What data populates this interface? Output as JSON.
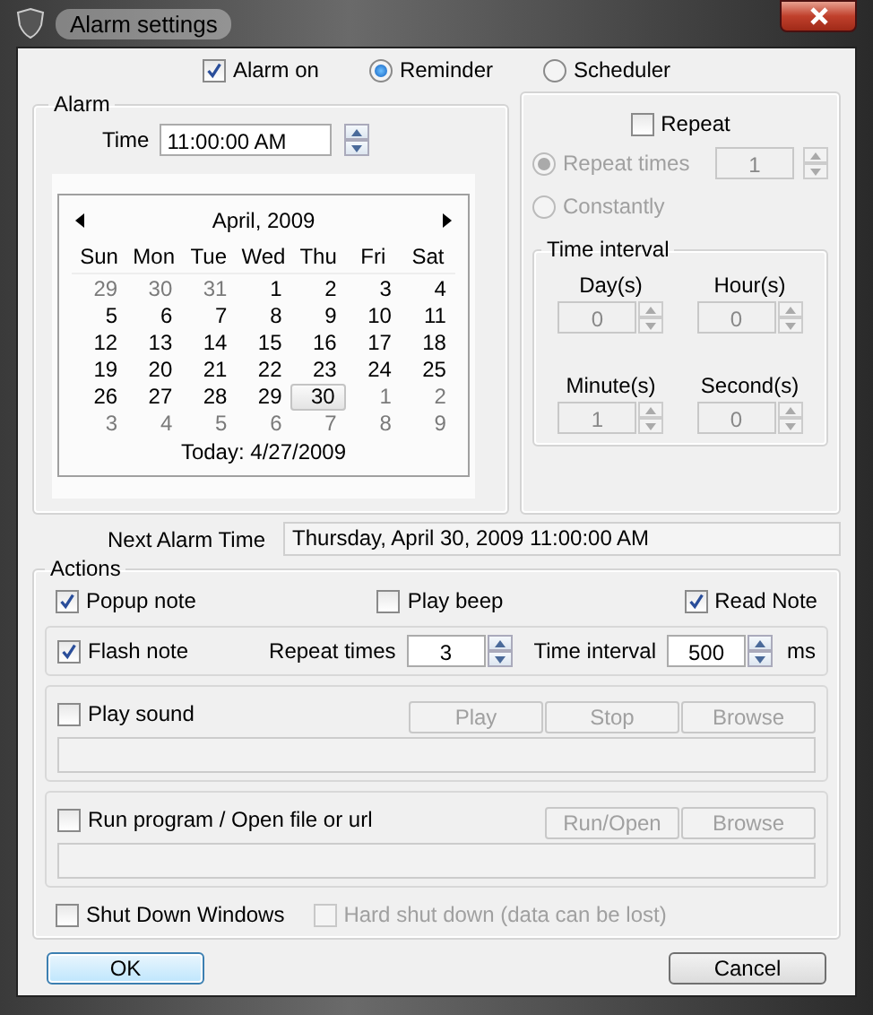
{
  "window": {
    "title": "Alarm settings"
  },
  "mode": {
    "alarm_on": {
      "label": "Alarm on",
      "checked": true
    },
    "options": [
      {
        "label": "Reminder",
        "selected": true
      },
      {
        "label": "Scheduler",
        "selected": false
      }
    ]
  },
  "alarm": {
    "title": "Alarm",
    "time_label": "Time",
    "time_value": "11:00:00 AM",
    "calendar": {
      "month": "April, 2009",
      "weekdays": [
        "Sun",
        "Mon",
        "Tue",
        "Wed",
        "Thu",
        "Fri",
        "Sat"
      ],
      "weeks": [
        [
          {
            "day": "29",
            "other_month": true,
            "selected": false
          },
          {
            "day": "30",
            "other_month": true,
            "selected": false
          },
          {
            "day": "31",
            "other_month": true,
            "selected": false
          },
          {
            "day": "1",
            "other_month": false,
            "selected": false
          },
          {
            "day": "2",
            "other_month": false,
            "selected": false
          },
          {
            "day": "3",
            "other_month": false,
            "selected": false
          },
          {
            "day": "4",
            "other_month": false,
            "selected": false
          }
        ],
        [
          {
            "day": "5",
            "other_month": false,
            "selected": false
          },
          {
            "day": "6",
            "other_month": false,
            "selected": false
          },
          {
            "day": "7",
            "other_month": false,
            "selected": false
          },
          {
            "day": "8",
            "other_month": false,
            "selected": false
          },
          {
            "day": "9",
            "other_month": false,
            "selected": false
          },
          {
            "day": "10",
            "other_month": false,
            "selected": false
          },
          {
            "day": "11",
            "other_month": false,
            "selected": false
          }
        ],
        [
          {
            "day": "12",
            "other_month": false,
            "selected": false
          },
          {
            "day": "13",
            "other_month": false,
            "selected": false
          },
          {
            "day": "14",
            "other_month": false,
            "selected": false
          },
          {
            "day": "15",
            "other_month": false,
            "selected": false
          },
          {
            "day": "16",
            "other_month": false,
            "selected": false
          },
          {
            "day": "17",
            "other_month": false,
            "selected": false
          },
          {
            "day": "18",
            "other_month": false,
            "selected": false
          }
        ],
        [
          {
            "day": "19",
            "other_month": false,
            "selected": false
          },
          {
            "day": "20",
            "other_month": false,
            "selected": false
          },
          {
            "day": "21",
            "other_month": false,
            "selected": false
          },
          {
            "day": "22",
            "other_month": false,
            "selected": false
          },
          {
            "day": "23",
            "other_month": false,
            "selected": false
          },
          {
            "day": "24",
            "other_month": false,
            "selected": false
          },
          {
            "day": "25",
            "other_month": false,
            "selected": false
          }
        ],
        [
          {
            "day": "26",
            "other_month": false,
            "selected": false
          },
          {
            "day": "27",
            "other_month": false,
            "selected": false
          },
          {
            "day": "28",
            "other_month": false,
            "selected": false
          },
          {
            "day": "29",
            "other_month": false,
            "selected": false
          },
          {
            "day": "30",
            "other_month": false,
            "selected": true
          },
          {
            "day": "1",
            "other_month": true,
            "selected": false
          },
          {
            "day": "2",
            "other_month": true,
            "selected": false
          }
        ],
        [
          {
            "day": "3",
            "other_month": true,
            "selected": false
          },
          {
            "day": "4",
            "other_month": true,
            "selected": false
          },
          {
            "day": "5",
            "other_month": true,
            "selected": false
          },
          {
            "day": "6",
            "other_month": true,
            "selected": false
          },
          {
            "day": "7",
            "other_month": true,
            "selected": false
          },
          {
            "day": "8",
            "other_month": true,
            "selected": false
          },
          {
            "day": "9",
            "other_month": true,
            "selected": false
          }
        ]
      ],
      "today": "Today: 4/27/2009"
    }
  },
  "repeat": {
    "label": "Repeat",
    "checked": false,
    "disabled": true,
    "options": [
      {
        "label": "Repeat times",
        "selected": true
      },
      {
        "label": "Constantly",
        "selected": false
      }
    ],
    "repeat_value": "1",
    "interval": {
      "title": "Time interval",
      "fields": [
        {
          "label": "Day(s)",
          "value": "0"
        },
        {
          "label": "Hour(s)",
          "value": "0"
        },
        {
          "label": "Minute(s)",
          "value": "1"
        },
        {
          "label": "Second(s)",
          "value": "0"
        }
      ]
    }
  },
  "next_alarm": {
    "label": "Next Alarm Time",
    "value": "Thursday, April 30, 2009 11:00:00 AM"
  },
  "actions": {
    "title": "Actions",
    "notes": [
      {
        "label": "Popup note",
        "checked": true
      },
      {
        "label": "Play beep",
        "checked": false
      },
      {
        "label": "Read Note",
        "checked": true
      }
    ],
    "flash": {
      "label": "Flash note",
      "checked": true,
      "repeat_label": "Repeat times",
      "repeat_value": "3",
      "interval_label": "Time interval",
      "interval_value": "500",
      "unit": "ms"
    },
    "sound": {
      "label": "Play sound",
      "checked": false,
      "buttons": [
        {
          "label": "Play",
          "disabled": true
        },
        {
          "label": "Stop",
          "disabled": true
        },
        {
          "label": "Browse",
          "disabled": true
        }
      ]
    },
    "run": {
      "label": "Run program / Open file or url",
      "checked": false,
      "buttons": [
        {
          "label": "Run/Open",
          "disabled": true
        },
        {
          "label": "Browse",
          "disabled": true
        }
      ]
    },
    "shutdown": {
      "label": "Shut Down Windows",
      "checked": false,
      "disabled": false
    },
    "hard_shutdown": {
      "label": "Hard shut down (data can be lost)",
      "checked": false,
      "disabled": true
    }
  },
  "buttons": [
    {
      "label": "OK",
      "default": true
    },
    {
      "label": "Cancel",
      "default": false
    }
  ]
}
